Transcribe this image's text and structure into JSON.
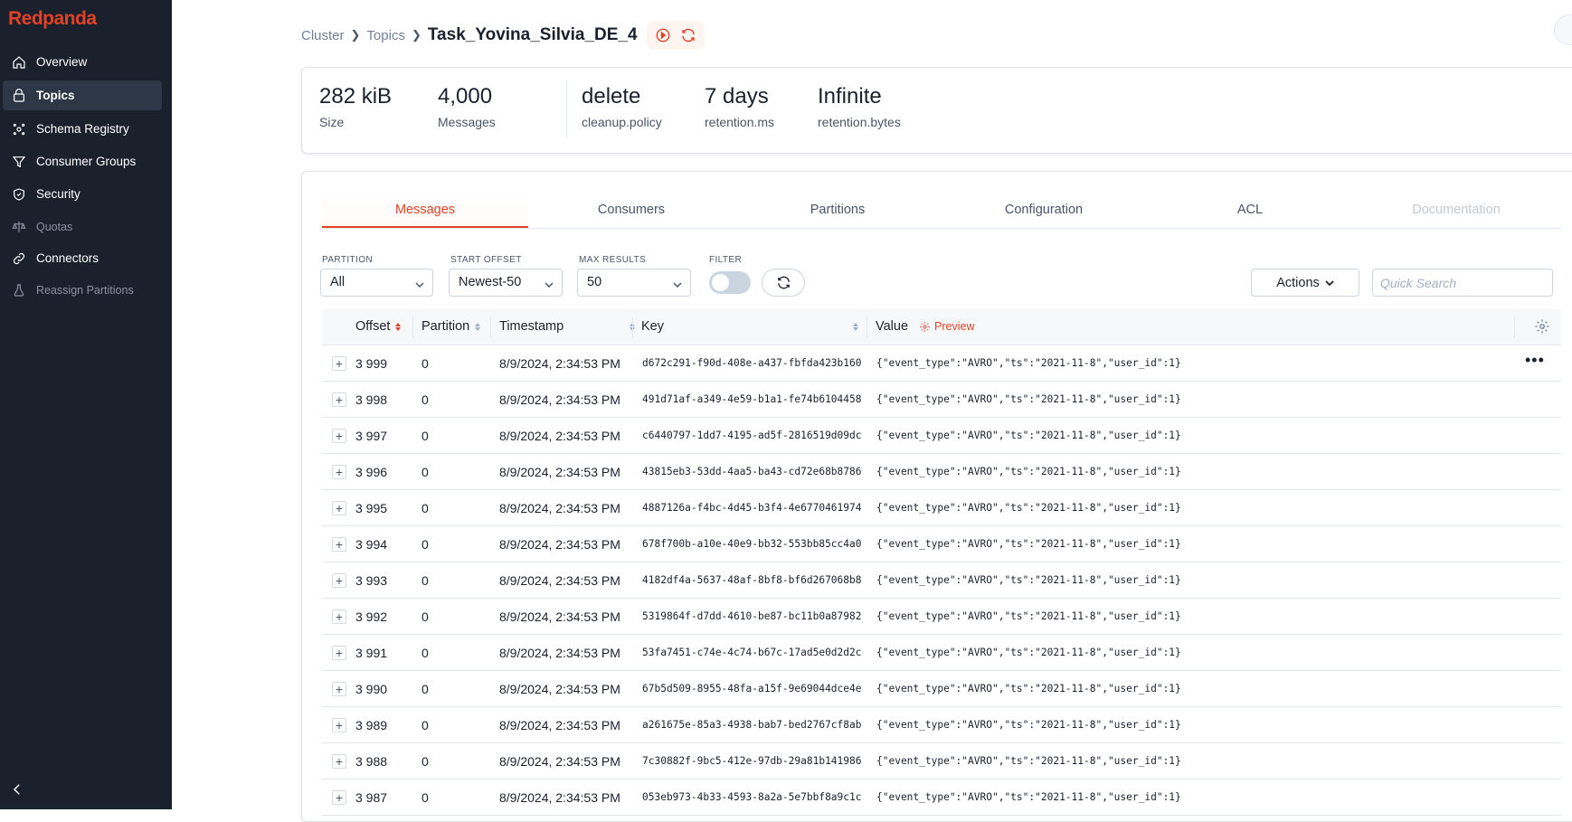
{
  "app": {
    "logo": "Redpanda"
  },
  "sidebar": {
    "items": [
      {
        "label": "Overview",
        "icon": "home-icon",
        "active": false,
        "disabled": false
      },
      {
        "label": "Topics",
        "icon": "topics-icon",
        "active": true,
        "disabled": false
      },
      {
        "label": "Schema Registry",
        "icon": "schema-icon",
        "active": false,
        "disabled": false
      },
      {
        "label": "Consumer Groups",
        "icon": "funnel-icon",
        "active": false,
        "disabled": false
      },
      {
        "label": "Security",
        "icon": "shield-icon",
        "active": false,
        "disabled": false
      },
      {
        "label": "Quotas",
        "icon": "scale-icon",
        "active": false,
        "disabled": true
      },
      {
        "label": "Connectors",
        "icon": "link-icon",
        "active": false,
        "disabled": false
      },
      {
        "label": "Reassign Partitions",
        "icon": "flask-icon",
        "active": false,
        "disabled": true
      }
    ]
  },
  "breadcrumb": {
    "cluster": "Cluster",
    "topics": "Topics",
    "current": "Task_Yovina_Silvia_DE_4"
  },
  "stats": {
    "size": {
      "value": "282 kiB",
      "label": "Size"
    },
    "messages": {
      "value": "4,000",
      "label": "Messages"
    },
    "cleanup": {
      "value": "delete",
      "label": "cleanup.policy"
    },
    "retention_ms": {
      "value": "7 days",
      "label": "retention.ms"
    },
    "retention_bytes": {
      "value": "Infinite",
      "label": "retention.bytes"
    }
  },
  "tabs": [
    {
      "label": "Messages",
      "active": true,
      "disabled": false
    },
    {
      "label": "Consumers",
      "active": false,
      "disabled": false
    },
    {
      "label": "Partitions",
      "active": false,
      "disabled": false
    },
    {
      "label": "Configuration",
      "active": false,
      "disabled": false
    },
    {
      "label": "ACL",
      "active": false,
      "disabled": false
    },
    {
      "label": "Documentation",
      "active": false,
      "disabled": true
    }
  ],
  "filters": {
    "partition": {
      "label": "PARTITION",
      "value": "All"
    },
    "start_offset": {
      "label": "START OFFSET",
      "value": "Newest-50"
    },
    "max_results": {
      "label": "MAX RESULTS",
      "value": "50"
    },
    "filter": {
      "label": "FILTER",
      "enabled": false
    },
    "actions_label": "Actions",
    "search_placeholder": "Quick Search"
  },
  "table": {
    "columns": {
      "offset": "Offset",
      "partition": "Partition",
      "timestamp": "Timestamp",
      "key": "Key",
      "value": "Value",
      "preview": "Preview"
    },
    "rows": [
      {
        "offset": "3 999",
        "partition": "0",
        "timestamp": "8/9/2024, 2:34:53 PM",
        "key": "d672c291-f90d-408e-a437-fbfda423b160",
        "value": "{\"event_type\":\"AVRO\",\"ts\":\"2021-11-8\",\"user_id\":1}"
      },
      {
        "offset": "3 998",
        "partition": "0",
        "timestamp": "8/9/2024, 2:34:53 PM",
        "key": "491d71af-a349-4e59-b1a1-fe74b6104458",
        "value": "{\"event_type\":\"AVRO\",\"ts\":\"2021-11-8\",\"user_id\":1}"
      },
      {
        "offset": "3 997",
        "partition": "0",
        "timestamp": "8/9/2024, 2:34:53 PM",
        "key": "c6440797-1dd7-4195-ad5f-2816519d09dc",
        "value": "{\"event_type\":\"AVRO\",\"ts\":\"2021-11-8\",\"user_id\":1}"
      },
      {
        "offset": "3 996",
        "partition": "0",
        "timestamp": "8/9/2024, 2:34:53 PM",
        "key": "43815eb3-53dd-4aa5-ba43-cd72e68b8786",
        "value": "{\"event_type\":\"AVRO\",\"ts\":\"2021-11-8\",\"user_id\":1}"
      },
      {
        "offset": "3 995",
        "partition": "0",
        "timestamp": "8/9/2024, 2:34:53 PM",
        "key": "4887126a-f4bc-4d45-b3f4-4e6770461974",
        "value": "{\"event_type\":\"AVRO\",\"ts\":\"2021-11-8\",\"user_id\":1}"
      },
      {
        "offset": "3 994",
        "partition": "0",
        "timestamp": "8/9/2024, 2:34:53 PM",
        "key": "678f700b-a10e-40e9-bb32-553bb85cc4a0",
        "value": "{\"event_type\":\"AVRO\",\"ts\":\"2021-11-8\",\"user_id\":1}"
      },
      {
        "offset": "3 993",
        "partition": "0",
        "timestamp": "8/9/2024, 2:34:53 PM",
        "key": "4182df4a-5637-48af-8bf8-bf6d267068b8",
        "value": "{\"event_type\":\"AVRO\",\"ts\":\"2021-11-8\",\"user_id\":1}"
      },
      {
        "offset": "3 992",
        "partition": "0",
        "timestamp": "8/9/2024, 2:34:53 PM",
        "key": "5319864f-d7dd-4610-be87-bc11b0a87982",
        "value": "{\"event_type\":\"AVRO\",\"ts\":\"2021-11-8\",\"user_id\":1}"
      },
      {
        "offset": "3 991",
        "partition": "0",
        "timestamp": "8/9/2024, 2:34:53 PM",
        "key": "53fa7451-c74e-4c74-b67c-17ad5e0d2d2c",
        "value": "{\"event_type\":\"AVRO\",\"ts\":\"2021-11-8\",\"user_id\":1}"
      },
      {
        "offset": "3 990",
        "partition": "0",
        "timestamp": "8/9/2024, 2:34:53 PM",
        "key": "67b5d509-8955-48fa-a15f-9e69044dce4e",
        "value": "{\"event_type\":\"AVRO\",\"ts\":\"2021-11-8\",\"user_id\":1}"
      },
      {
        "offset": "3 989",
        "partition": "0",
        "timestamp": "8/9/2024, 2:34:53 PM",
        "key": "a261675e-85a3-4938-bab7-bed2767cf8ab",
        "value": "{\"event_type\":\"AVRO\",\"ts\":\"2021-11-8\",\"user_id\":1}"
      },
      {
        "offset": "3 988",
        "partition": "0",
        "timestamp": "8/9/2024, 2:34:53 PM",
        "key": "7c30882f-9bc5-412e-97db-29a81b141986",
        "value": "{\"event_type\":\"AVRO\",\"ts\":\"2021-11-8\",\"user_id\":1}"
      },
      {
        "offset": "3 987",
        "partition": "0",
        "timestamp": "8/9/2024, 2:34:53 PM",
        "key": "053eb973-4b33-4593-8a2a-5e7bbf8a9c1c",
        "value": "{\"event_type\":\"AVRO\",\"ts\":\"2021-11-8\",\"user_id\":1}"
      }
    ]
  },
  "colors": {
    "brand": "#e14226",
    "sidebar_bg": "#1a202c"
  }
}
